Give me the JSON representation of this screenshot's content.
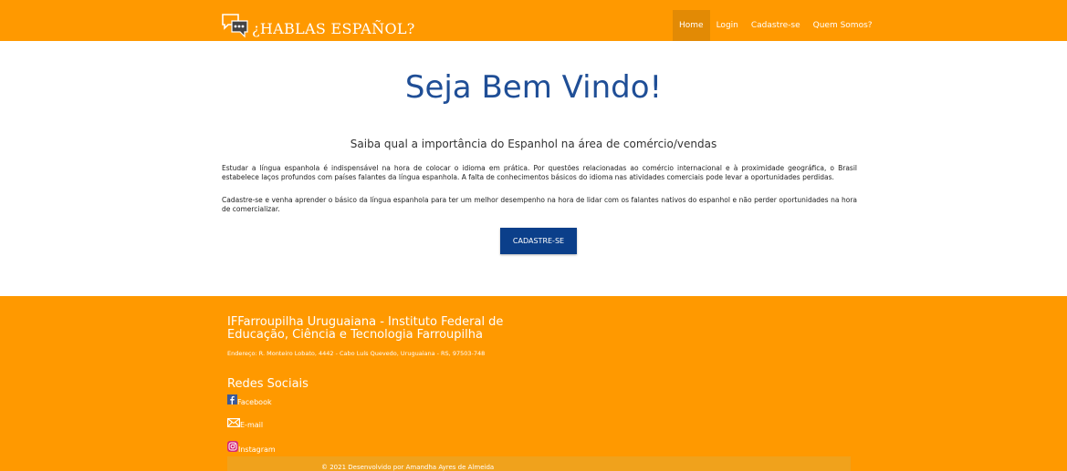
{
  "header": {
    "brand": "¿HABLAS ESPAÑOL?",
    "nav": [
      {
        "label": "Home",
        "active": true
      },
      {
        "label": "Login"
      },
      {
        "label": "Cadastre-se"
      },
      {
        "label": "Quem Somos?"
      }
    ]
  },
  "main": {
    "title": "Seja Bem Vindo!",
    "subtitle": "Saiba qual a importância do Espanhol na área de comércio/vendas",
    "paragraph1": "Estudar a língua espanhola é indispensável na hora de colocar o idioma em prática. Por questões relacionadas ao comércio internacional e à proximidade geográfica, o Brasil estabelece laços profundos com países falantes da língua espanhola. A falta de conhecimentos básicos do idioma nas atividades comerciais pode levar a oportunidades perdidas.",
    "paragraph2": "Cadastre-se e venha aprender o básico da língua espanhola para ter um melhor desempenho na hora de lidar com os falantes nativos do espanhol e não perder oportunidades na hora de comercializar.",
    "cta_label": "CADASTRE-SE"
  },
  "footer": {
    "institution": "IFFarroupilha Uruguaiana - Instituto Federal de Educação, Ciência e Tecnologia Farroupilha",
    "address": "Endereço: R. Monteiro Lobato, 4442 - Cabo Luís Quevedo, Uruguaiana - RS, 97503-748",
    "social_title": "Redes Sociais",
    "social": [
      {
        "label": "Facebook",
        "icon": "facebook-icon"
      },
      {
        "label": "E-mail",
        "icon": "mail-icon"
      },
      {
        "label": "Instagram",
        "icon": "instagram-icon"
      }
    ],
    "copyright": "© 2021 Desenvolvido por Amandha Ayres de Almeida"
  },
  "colors": {
    "accent": "#ff9900",
    "title": "#1f4e96",
    "button": "#0b3f8a"
  }
}
